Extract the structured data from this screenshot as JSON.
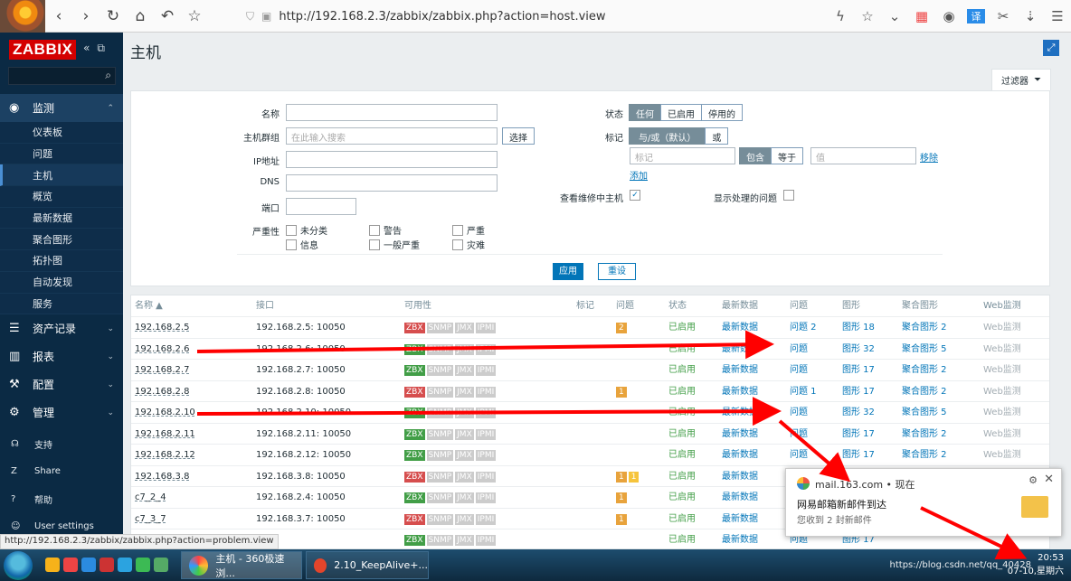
{
  "browser": {
    "url": "http://192.168.2.3/zabbix/zabbix.php?action=host.view",
    "status_url": "http://192.168.2.3/zabbix/zabbix.php?action=problem.view"
  },
  "sidebar": {
    "logo": "ZABBIX",
    "sections": [
      {
        "label": "监测",
        "icon": "eye-icon",
        "open": true,
        "items": [
          "仪表板",
          "问题",
          "主机",
          "概览",
          "最新数据",
          "聚合图形",
          "拓扑图",
          "自动发现",
          "服务"
        ]
      },
      {
        "label": "资产记录",
        "icon": "list-icon"
      },
      {
        "label": "报表",
        "icon": "bar-chart-icon"
      },
      {
        "label": "配置",
        "icon": "wrench-icon"
      },
      {
        "label": "管理",
        "icon": "gear-icon"
      }
    ],
    "bottom": [
      {
        "label": "支持",
        "icon": "headset-icon"
      },
      {
        "label": "Share",
        "icon": "share-icon"
      },
      {
        "label": "帮助",
        "icon": "help-icon"
      },
      {
        "label": "User settings",
        "icon": "user-icon"
      }
    ]
  },
  "page": {
    "title": "主机"
  },
  "filter": {
    "tab_label": "过滤器",
    "name_label": "名称",
    "hostgroup_label": "主机群组",
    "hostgroup_placeholder": "在此输入搜索",
    "select_button": "选择",
    "ip_label": "IP地址",
    "dns_label": "DNS",
    "port_label": "端口",
    "severity_label": "严重性",
    "severities": [
      "未分类",
      "警告",
      "严重",
      "信息",
      "一般严重",
      "灾难"
    ],
    "status_label": "状态",
    "status_options": [
      "任何",
      "已启用",
      "停用的"
    ],
    "tags_label": "标记",
    "tag_mode_options": [
      "与/或（默认）",
      "或"
    ],
    "tag_placeholder": "标记",
    "tag_op_options": [
      "包含",
      "等于"
    ],
    "value_placeholder": "值",
    "remove_link": "移除",
    "add_link": "添加",
    "maintenance_label": "查看维修中主机",
    "suppressed_label": "显示处理的问题",
    "apply_button": "应用",
    "reset_button": "重设"
  },
  "table": {
    "headers": [
      "名称 ▲",
      "接口",
      "可用性",
      "标记",
      "问题",
      "状态",
      "最新数据",
      "问题",
      "图形",
      "聚合图形",
      "Web监测"
    ],
    "rows": [
      {
        "name": "192.168.2.5",
        "iface": "192.168.2.5: 10050",
        "zbx": "red",
        "badges": [
          {
            "n": "2",
            "c": "orange"
          }
        ],
        "status": "已启用",
        "latest": "最新数据",
        "problems": "问题 2",
        "graphs": "图形 18",
        "screens": "聚合图形 2",
        "web": "Web监测"
      },
      {
        "name": "192.168.2.6",
        "iface": "192.168.2.6: 10050",
        "zbx": "green",
        "badges": [],
        "status": "已启用",
        "latest": "最新数据",
        "problems": "问题",
        "graphs": "图形 32",
        "screens": "聚合图形 5",
        "web": "Web监测"
      },
      {
        "name": "192.168.2.7",
        "iface": "192.168.2.7: 10050",
        "zbx": "green",
        "badges": [],
        "status": "已启用",
        "latest": "最新数据",
        "problems": "问题",
        "graphs": "图形 17",
        "screens": "聚合图形 2",
        "web": "Web监测"
      },
      {
        "name": "192.168.2.8",
        "iface": "192.168.2.8: 10050",
        "zbx": "red",
        "badges": [
          {
            "n": "1",
            "c": "orange"
          }
        ],
        "status": "已启用",
        "latest": "最新数据",
        "problems": "问题 1",
        "graphs": "图形 17",
        "screens": "聚合图形 2",
        "web": "Web监测"
      },
      {
        "name": "192.168.2.10",
        "iface": "192.168.2.10: 10050",
        "zbx": "green",
        "badges": [],
        "status": "已启用",
        "latest": "最新数据",
        "problems": "问题",
        "graphs": "图形 32",
        "screens": "聚合图形 5",
        "web": "Web监测"
      },
      {
        "name": "192.168.2.11",
        "iface": "192.168.2.11: 10050",
        "zbx": "green",
        "badges": [],
        "status": "已启用",
        "latest": "最新数据",
        "problems": "问题",
        "graphs": "图形 17",
        "screens": "聚合图形 2",
        "web": "Web监测"
      },
      {
        "name": "192.168.2.12",
        "iface": "192.168.2.12: 10050",
        "zbx": "green",
        "badges": [],
        "status": "已启用",
        "latest": "最新数据",
        "problems": "问题",
        "graphs": "图形 17",
        "screens": "聚合图形 2",
        "web": "Web监测"
      },
      {
        "name": "192.168.3.8",
        "iface": "192.168.3.8: 10050",
        "zbx": "red",
        "badges": [
          {
            "n": "1",
            "c": "orange"
          },
          {
            "n": "1",
            "c": "yellow"
          }
        ],
        "status": "已启用",
        "latest": "最新数据",
        "problems": "",
        "graphs": "",
        "screens": "",
        "web": ""
      },
      {
        "name": "c7_2_4",
        "iface": "192.168.2.4: 10050",
        "zbx": "green",
        "badges": [
          {
            "n": "1",
            "c": "orange"
          }
        ],
        "status": "已启用",
        "latest": "最新数据",
        "problems": "",
        "graphs": "",
        "screens": "",
        "web": ""
      },
      {
        "name": "c7_3_7",
        "iface": "192.168.3.7: 10050",
        "zbx": "red",
        "badges": [
          {
            "n": "1",
            "c": "orange"
          }
        ],
        "status": "已启用",
        "latest": "最新数据",
        "problems": "",
        "graphs": "",
        "screens": "",
        "web": ""
      },
      {
        "name": "",
        "iface": "",
        "zbx": "green",
        "badges": [],
        "status": "已启用",
        "latest": "最新数据",
        "problems": "问题",
        "graphs": "图形 17",
        "screens": "",
        "web": ""
      }
    ]
  },
  "notification": {
    "source": "mail.163.com",
    "time": "现在",
    "title": "网易邮箱新邮件到达",
    "body": "您收到 2 封新邮件"
  },
  "taskbar": {
    "windows": [
      "主机 - 360极速浏...",
      "2.10_KeepAlive+..."
    ],
    "time": "20:53",
    "date": "07-10,星期六",
    "watermark": "https://blog.csdn.net/qq_40428"
  },
  "colors": {
    "zbx_green": "#429e47",
    "zbx_red": "#d64e4e",
    "accent": "#0275b8",
    "annotation_arrows": "#ff0000"
  }
}
